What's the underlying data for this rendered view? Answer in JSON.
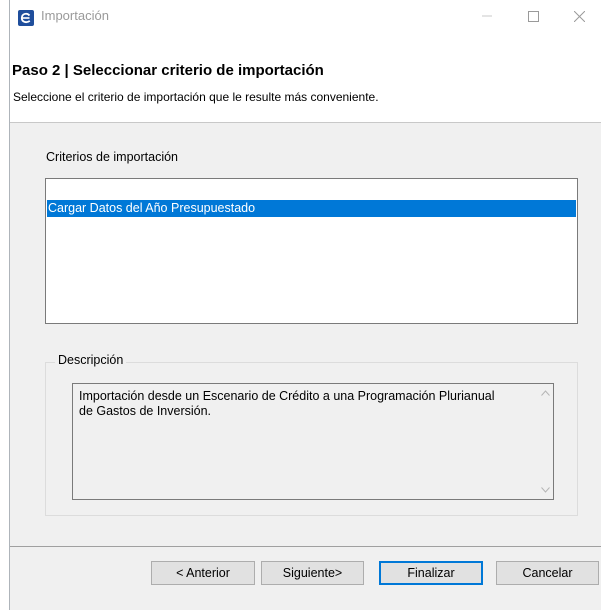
{
  "window": {
    "title": "Importación",
    "controls": {
      "minimize": "—",
      "maximize": "☐",
      "close": "✕"
    }
  },
  "header": {
    "step_title": "Paso 2 | Seleccionar criterio de importación",
    "step_description": "Seleccione el criterio de importación que le resulte más conveniente."
  },
  "criteria": {
    "label": "Criterios de importación",
    "items": [
      {
        "label": "Cargar Datos del Año Presupuestado",
        "selected": true
      }
    ]
  },
  "description": {
    "legend": "Descripción",
    "text": "Importación desde un Escenario de Crédito a una Programación Plurianual de Gastos de Inversión."
  },
  "buttons": {
    "previous": "< Anterior",
    "next": "Siguiente>",
    "finish": "Finalizar",
    "cancel": "Cancelar"
  },
  "colors": {
    "selection": "#0078d7",
    "dialog_bg": "#f0f0f0"
  },
  "icons": {
    "app": "app-e-icon",
    "scroll_up": "chevron-up-icon",
    "scroll_down": "chevron-down-icon"
  }
}
